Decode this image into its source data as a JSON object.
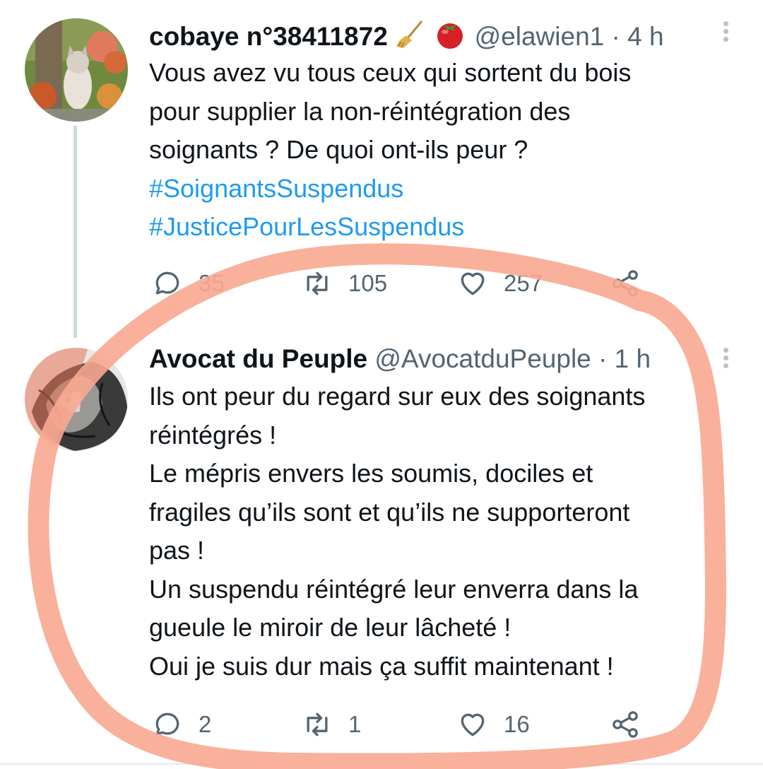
{
  "tweets": [
    {
      "name": "cobaye n°38411872",
      "emojis": [
        "broom-emoji",
        "tomato-emoji"
      ],
      "handle": "@elawien1",
      "separator": "·",
      "time": "4 h",
      "lines": [
        "Vous avez vu tous ceux qui sortent du bois",
        "pour supplier la non-réintégration des",
        "soignants ? De quoi ont-ils peur ?"
      ],
      "hashtags": [
        "#SoignantsSuspendus",
        "#JusticePourLesSuspendus"
      ],
      "replies": "35",
      "retweets": "105",
      "likes": "257"
    },
    {
      "name": "Avocat du Peuple",
      "handle": "@AvocatduPeuple",
      "separator": "·",
      "time": "1 h",
      "lines": [
        "Ils ont peur du regard sur eux des soignants",
        "réintégrés !",
        "Le mépris envers les soumis, dociles et",
        "fragiles qu’ils sont et qu’ils ne supporteront",
        "pas !",
        "Un suspendu réintégré leur enverra dans la",
        "gueule le miroir de leur lâcheté !",
        "Oui je suis dur mais ça suffit maintenant !"
      ],
      "replies": "2",
      "retweets": "1",
      "likes": "16"
    }
  ],
  "icons": {
    "reply": "speech-bubble-icon",
    "retweet": "retweet-arrows-icon",
    "like": "heart-icon",
    "share": "share-icon",
    "more": "vertical-ellipsis-icon"
  },
  "colors": {
    "text": "#0f1419",
    "muted": "#536471",
    "hashtag": "#1d9bf0",
    "thread_line": "#cfd9de",
    "highlight_circle": "#f8a891"
  }
}
